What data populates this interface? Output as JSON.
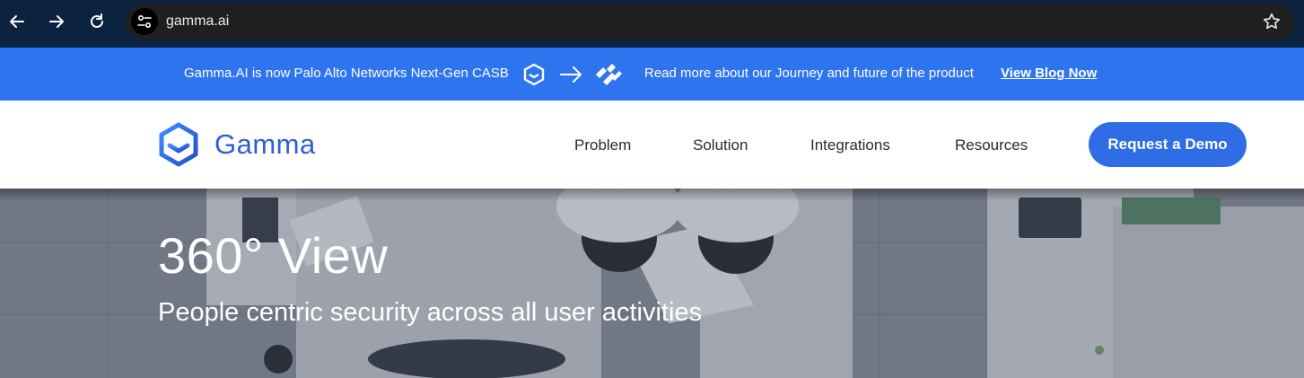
{
  "browser": {
    "url": "gamma.ai",
    "icons": [
      "back-arrow-icon",
      "forward-arrow-icon",
      "reload-icon",
      "site-info-icon",
      "bookmark-star-icon"
    ]
  },
  "banner": {
    "text": "Gamma.AI is now Palo Alto Networks Next-Gen CASB",
    "subtext": "Read more about our Journey and future of the product",
    "link_label": "View Blog Now",
    "background": "#2f74ef"
  },
  "header": {
    "logo_text": "Gamma",
    "nav": [
      {
        "label": "Problem"
      },
      {
        "label": "Solution"
      },
      {
        "label": "Integrations"
      },
      {
        "label": "Resources"
      }
    ],
    "cta_label": "Request a Demo",
    "brand_color": "#2f6de6"
  },
  "hero": {
    "title": "360° View",
    "subtitle": "People centric security across all user activities"
  }
}
